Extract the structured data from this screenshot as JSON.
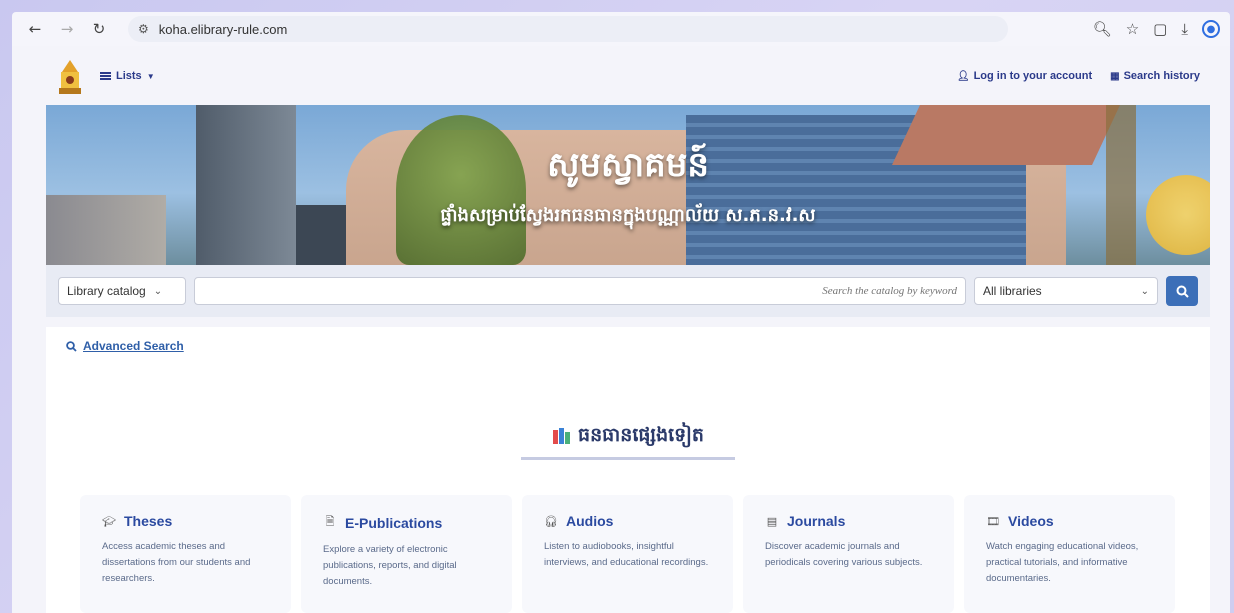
{
  "browser": {
    "url": "koha.elibrary-rule.com"
  },
  "topnav": {
    "lists_label": "Lists",
    "login_label": "Log in to your account",
    "history_label": "Search history"
  },
  "hero": {
    "title": "សូមស្វាគមន៍",
    "subtitle": "ផ្ទាំងសម្រាប់ស្វែងរកធនធានក្នុងបណ្ណាល័យ ស.ភ.ន.វ.ស"
  },
  "search": {
    "catalog_select": "Library catalog",
    "placeholder": "Search the catalog by keyword",
    "library_select": "All libraries"
  },
  "content": {
    "advanced_search": "Advanced Search",
    "section_title": "ធនធានផ្សេងទៀត",
    "cards": [
      {
        "icon": "graduation-cap-icon",
        "title": "Theses",
        "desc": "Access academic theses and dissertations from our students and researchers."
      },
      {
        "icon": "file-icon",
        "title": "E-Publications",
        "desc": "Explore a variety of electronic publications, reports, and digital documents."
      },
      {
        "icon": "headphones-icon",
        "title": "Audios",
        "desc": "Listen to audiobooks, insightful interviews, and educational recordings."
      },
      {
        "icon": "newspaper-icon",
        "title": "Journals",
        "desc": "Discover academic journals and periodicals covering various subjects."
      },
      {
        "icon": "film-icon",
        "title": "Videos",
        "desc": "Watch engaging educational videos, practical tutorials, and informative documentaries."
      }
    ]
  },
  "colors": {
    "accent": "#3c6fb8",
    "link": "#2f5fa8",
    "nav": "#2b3a8a"
  }
}
